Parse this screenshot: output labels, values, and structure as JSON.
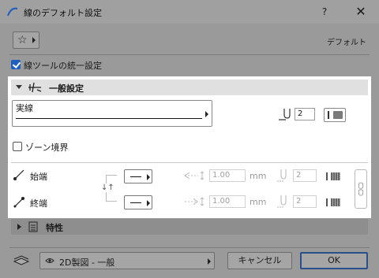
{
  "window": {
    "title": "線のデフォルト設定",
    "help": "?",
    "close": "✕"
  },
  "favorites": {
    "star": "☆",
    "default_label": "デフォルト"
  },
  "unify": {
    "label": "線ツールの統一設定",
    "checked": true
  },
  "general": {
    "section_label": "一般設定",
    "line_type": "実線",
    "pen_number": "2"
  },
  "zone": {
    "label": "ゾーン境界",
    "checked": false
  },
  "ends": {
    "start": {
      "label": "始端",
      "size": "1.00",
      "unit": "mm",
      "pen": "2"
    },
    "end": {
      "label": "終端",
      "size": "1.00",
      "unit": "mm",
      "pen": "2"
    },
    "swap": "↓↑"
  },
  "properties": {
    "section_label": "特性"
  },
  "footer": {
    "view_label": "2D製図 - 一般",
    "cancel_label": "キャンセル",
    "ok_label": "OK"
  },
  "colors": {
    "accent": "#1f5fbf",
    "panel": "#ffffff",
    "dimmed": "#9a9a9a"
  }
}
